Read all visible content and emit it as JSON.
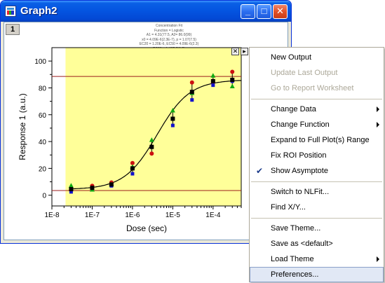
{
  "window": {
    "title": "Graph2",
    "layer_number": "1",
    "buttons": {
      "minimize": "_",
      "maximize": "□",
      "close": "✕"
    }
  },
  "fit_info": [
    "Concentration Fit",
    "Function = Logistic",
    "A1 = 4.31(77.5, A2= 86.0(99)",
    "x0 = 4.09E-6(2.3E-7), p = 1.07(7.5)",
    "EC20 = 1.20E-6, EC50 = 4.09E-6(2.3)",
    "EC80 = 1.40E-5(1.5)"
  ],
  "graph": {
    "roi_close": "✕",
    "roi_menu": "▸"
  },
  "chart_data": {
    "type": "scatter",
    "xlabel": "Dose (sec)",
    "ylabel": "Response 1 (a.u.)",
    "xscale": "log",
    "xlim": [
      1e-08,
      0.0005
    ],
    "ylim": [
      -8,
      110
    ],
    "xticks": [
      "1E-8",
      "1E-7",
      "1E-6",
      "1E-5",
      "1E-4"
    ],
    "yticks": [
      "0",
      "20",
      "40",
      "60",
      "80",
      "100"
    ],
    "roi_background": "#ffff99",
    "asymptote_lines": [
      3.5,
      88.5
    ],
    "asymptote_color": "#9b1c1c",
    "x": [
      3e-08,
      1e-07,
      3e-07,
      1e-06,
      3e-06,
      1e-05,
      3e-05,
      0.0001,
      0.0003
    ],
    "series": [
      {
        "color": "#cc1111",
        "marker": "circle",
        "values": [
          4.5,
          7,
          9.5,
          24,
          31,
          57,
          84,
          84,
          92
        ]
      },
      {
        "color": "#11aa11",
        "marker": "triangle",
        "values": [
          7,
          4,
          8,
          21,
          41,
          63,
          76,
          89,
          81
        ]
      },
      {
        "color": "#1111cc",
        "marker": "square",
        "values": [
          2.5,
          5.5,
          7,
          16,
          36,
          52,
          71,
          82,
          85
        ]
      },
      {
        "color": "#000000",
        "marker": "square",
        "values": [
          4.5,
          5.5,
          8,
          20,
          36,
          57,
          77,
          85,
          86
        ]
      }
    ],
    "fit": {
      "A1": 4.31,
      "A2": 86.0,
      "x0": 4.09e-06,
      "p": 1.07,
      "color": "#000000"
    }
  },
  "menu": {
    "items": [
      {
        "label": "New Output",
        "enabled": true
      },
      {
        "label": "Update Last Output",
        "enabled": false
      },
      {
        "label": "Go to Report Worksheet",
        "enabled": false
      },
      {
        "label": "Change Data",
        "enabled": true,
        "submenu": true
      },
      {
        "label": "Change Function",
        "enabled": true,
        "submenu": true
      },
      {
        "label": "Expand to Full Plot(s) Range",
        "enabled": true
      },
      {
        "label": "Fix ROI Position",
        "enabled": true
      },
      {
        "label": "Show Asymptote",
        "enabled": true,
        "checked": true
      },
      {
        "label": "Switch to NLFit...",
        "enabled": true
      },
      {
        "label": "Find X/Y...",
        "enabled": true
      },
      {
        "label": "Save Theme...",
        "enabled": true
      },
      {
        "label": "Save as <default>",
        "enabled": true
      },
      {
        "label": "Load Theme",
        "enabled": true,
        "submenu": true
      },
      {
        "label": "Preferences...",
        "enabled": true,
        "highlighted": true
      }
    ]
  }
}
